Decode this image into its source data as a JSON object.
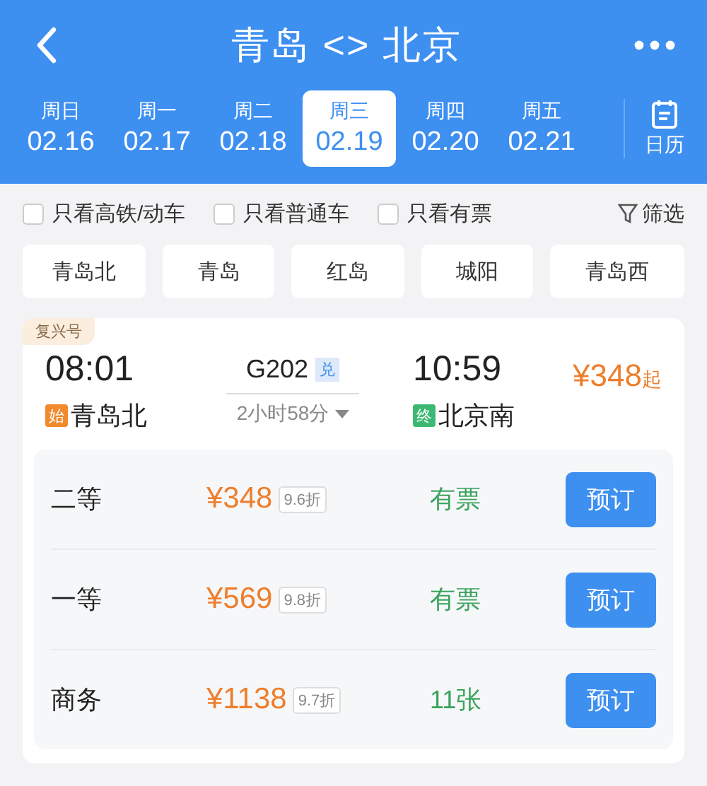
{
  "header": {
    "title": "青岛 <> 北京"
  },
  "dates": [
    {
      "weekday": "周日",
      "date": "02.16",
      "selected": false
    },
    {
      "weekday": "周一",
      "date": "02.17",
      "selected": false
    },
    {
      "weekday": "周二",
      "date": "02.18",
      "selected": false
    },
    {
      "weekday": "周三",
      "date": "02.19",
      "selected": true
    },
    {
      "weekday": "周四",
      "date": "02.20",
      "selected": false
    },
    {
      "weekday": "周五",
      "date": "02.21",
      "selected": false
    }
  ],
  "calendar": {
    "label": "日历"
  },
  "filters": [
    {
      "label": "只看高铁/动车",
      "checked": false
    },
    {
      "label": "只看普通车",
      "checked": false
    },
    {
      "label": "只看有票",
      "checked": false
    }
  ],
  "filter_button": "筛选",
  "stations": [
    "青岛北",
    "青岛",
    "红岛",
    "城阳",
    "青岛西"
  ],
  "train": {
    "badge": "复兴号",
    "depart_time": "08:01",
    "number": "G202",
    "number_tag": "兑",
    "arrive_time": "10:59",
    "price": "¥348",
    "price_suffix": "起",
    "from_tag": "始",
    "from_station": "青岛北",
    "duration": "2小时58分",
    "to_tag": "终",
    "to_station": "北京南",
    "seats": [
      {
        "class": "二等",
        "price": "¥348",
        "discount": "9.6折",
        "availability": "有票",
        "button": "预订"
      },
      {
        "class": "一等",
        "price": "¥569",
        "discount": "9.8折",
        "availability": "有票",
        "button": "预订"
      },
      {
        "class": "商务",
        "price": "¥1138",
        "discount": "9.7折",
        "availability": "11张",
        "button": "预订"
      }
    ]
  }
}
